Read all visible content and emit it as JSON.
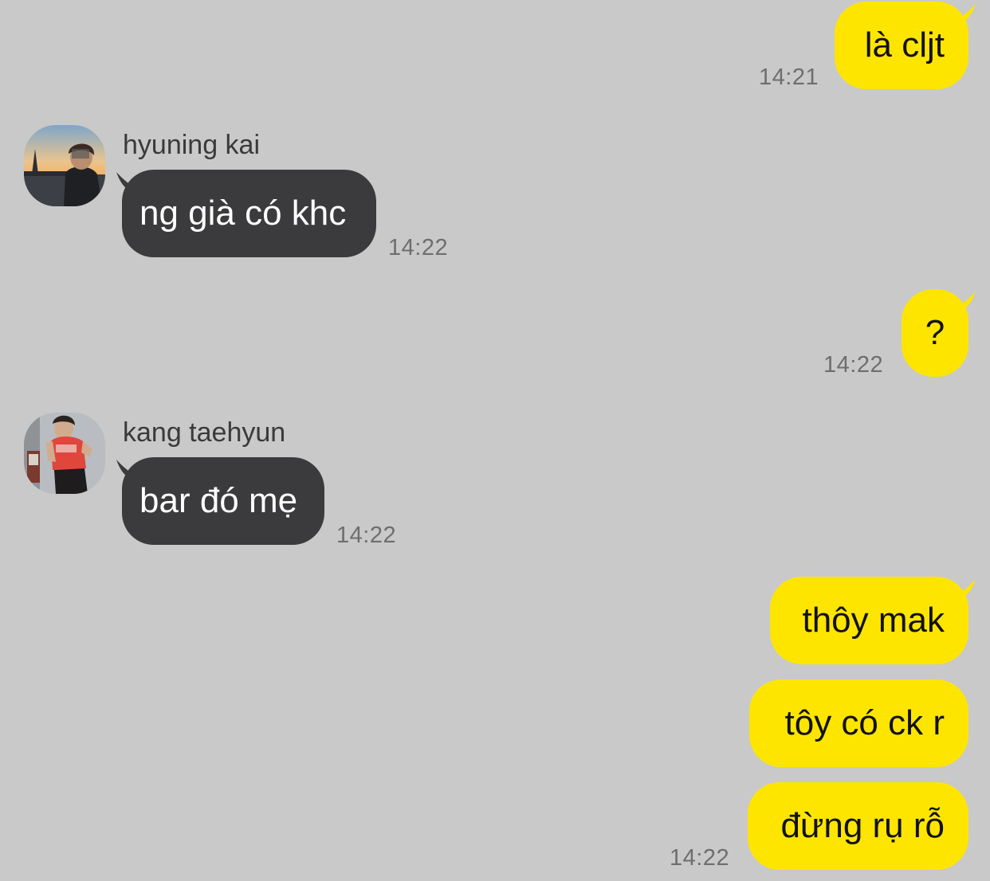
{
  "theme": {
    "background": "#c9c9c9",
    "my_bubble": "#fee500",
    "their_bubble": "#3b3b3d",
    "time_color": "#6e6e6e"
  },
  "messages": {
    "m1": {
      "text": "là cljt",
      "time": "14:21"
    },
    "m2": {
      "sender": "hyuning kai",
      "avatar": "avatar-photo-sunset-city",
      "text": "ng già có khc",
      "time": "14:22"
    },
    "m3": {
      "text": "?",
      "time": "14:22"
    },
    "m4": {
      "sender": "kang taehyun",
      "avatar": "avatar-photo-red-shirt",
      "text": "bar đó mẹ",
      "time": "14:22"
    },
    "m5": {
      "text": "thôy mak"
    },
    "m6": {
      "text": "tôy có ck r"
    },
    "m7": {
      "text": "đừng rụ rỗ",
      "time": "14:22"
    }
  }
}
